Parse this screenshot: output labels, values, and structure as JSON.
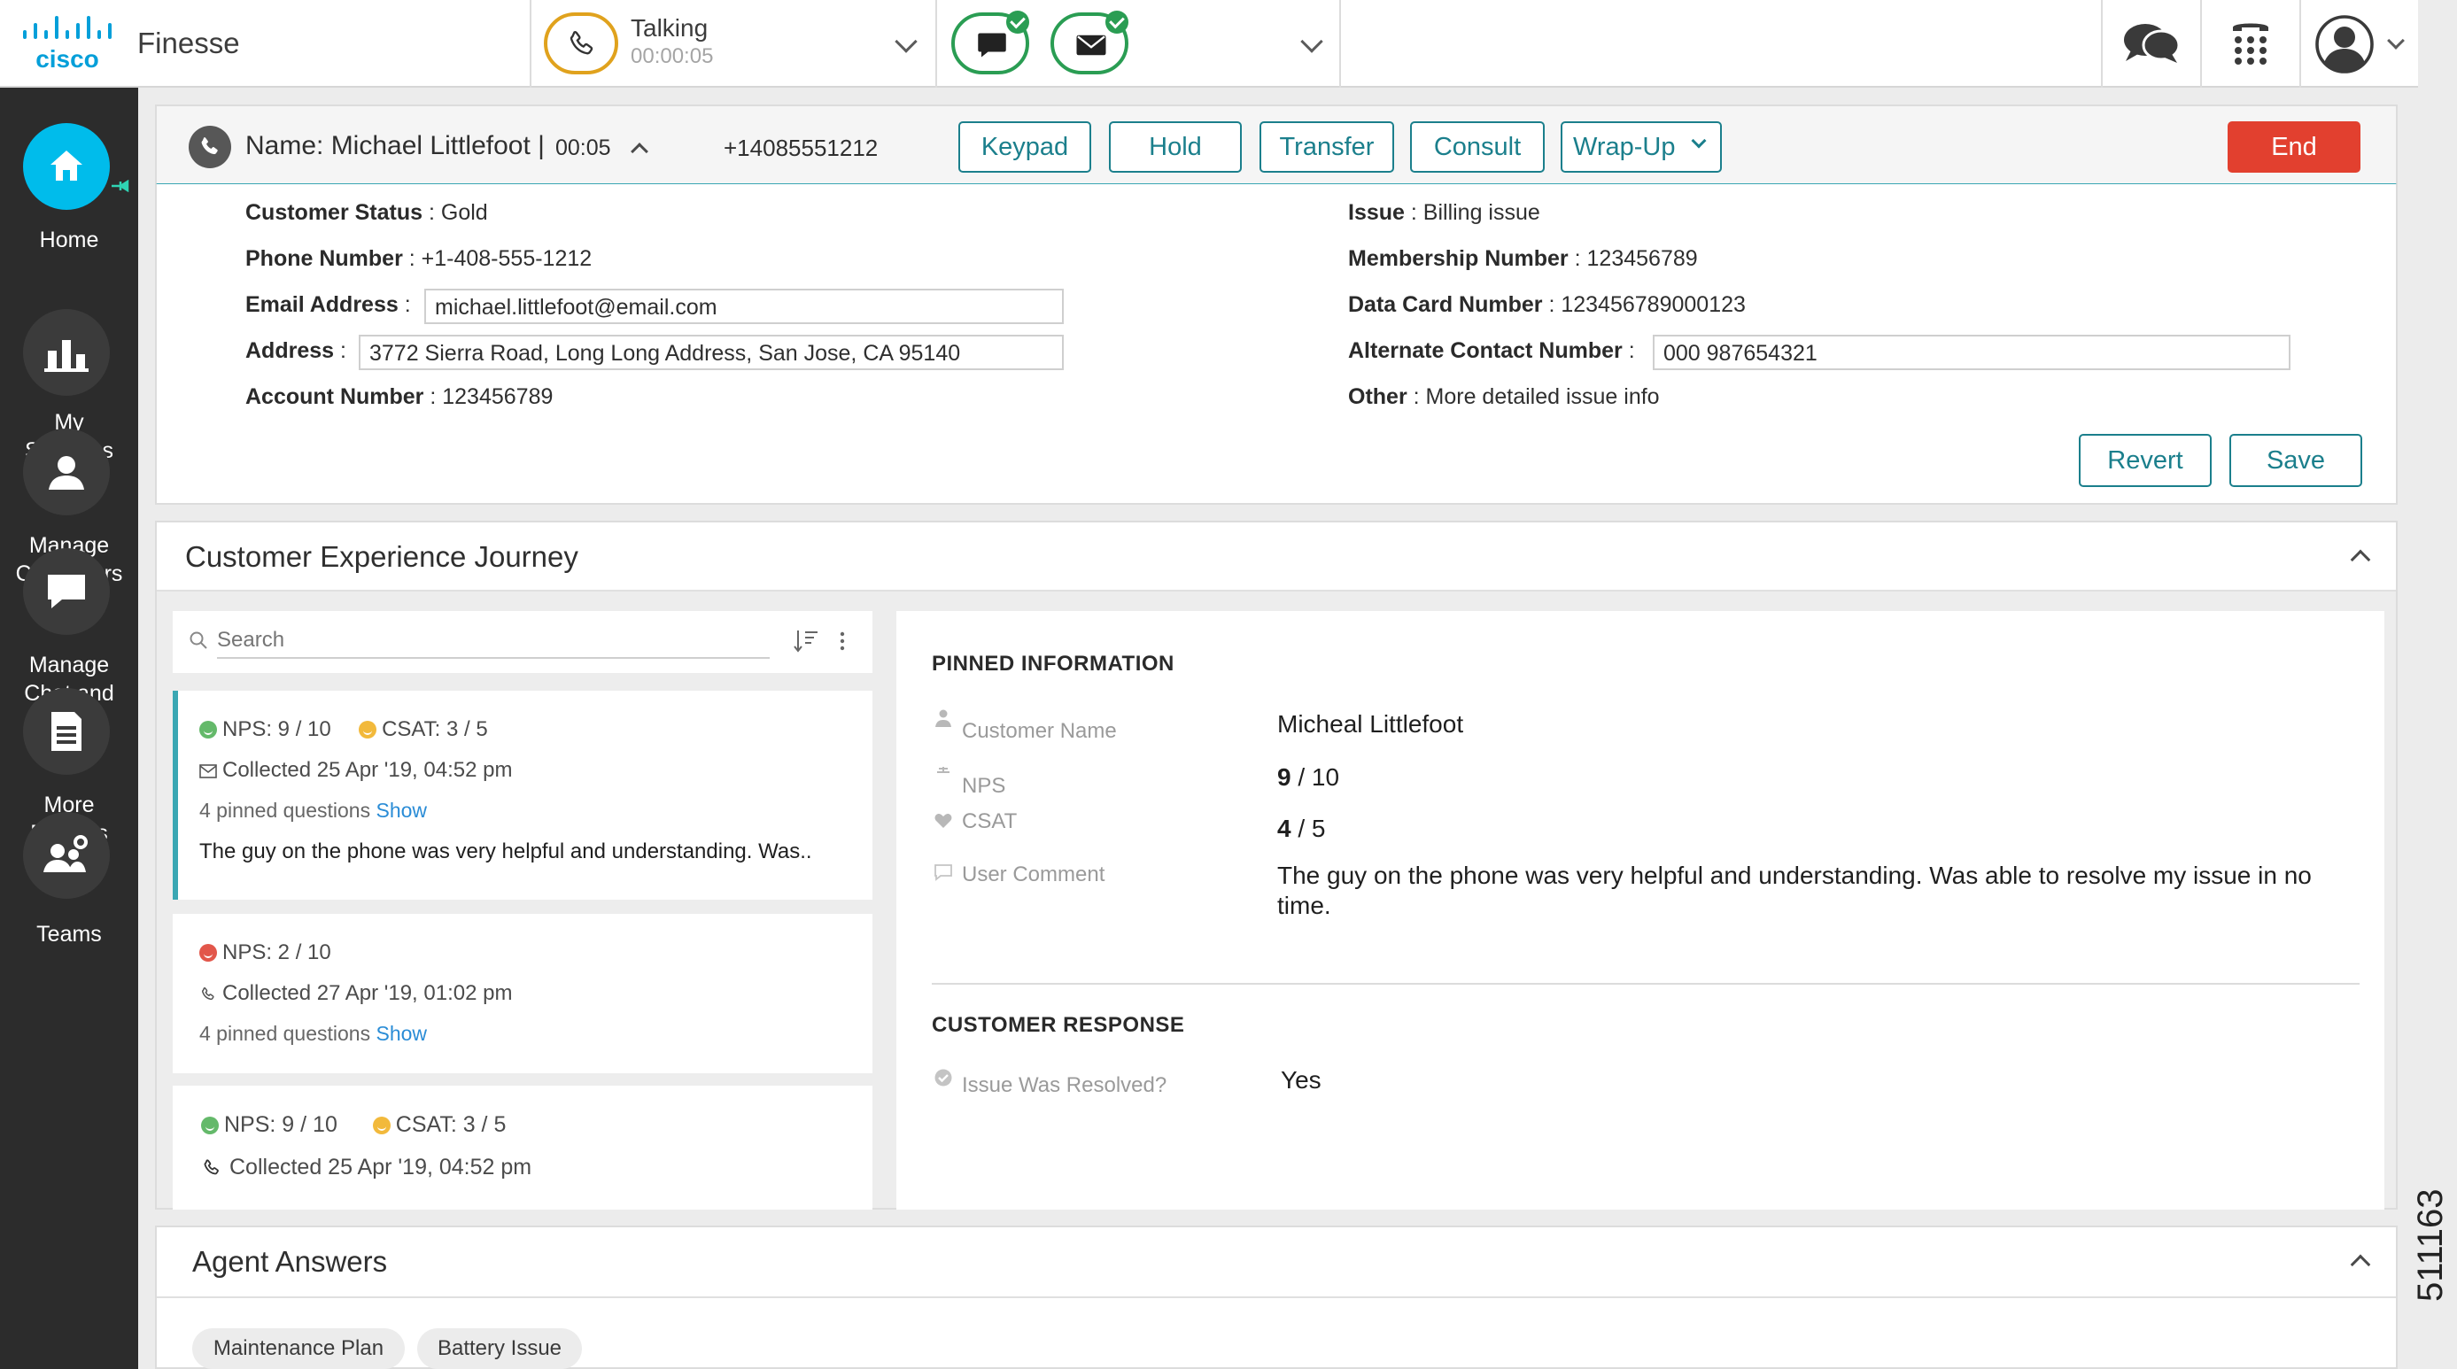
{
  "app": {
    "name": "Finesse",
    "logo_text": "cisco"
  },
  "topbar": {
    "voice": {
      "status": "Talking",
      "timer": "00:00:05"
    }
  },
  "sidebar": {
    "items": [
      {
        "label": "Home",
        "icon": "home-icon",
        "active": true
      },
      {
        "label": "My Statistics",
        "lines": [
          "My",
          "Statistics"
        ],
        "icon": "bar-chart-icon"
      },
      {
        "label": "Manage Customers",
        "lines": [
          "Manage",
          "Customers"
        ],
        "icon": "person-icon"
      },
      {
        "label": "Manage Chat and Email",
        "lines": [
          "Manage",
          "Chat and",
          "Email"
        ],
        "icon": "chat-bubble-icon"
      },
      {
        "label": "More Reports",
        "lines": [
          "More",
          "Reports"
        ],
        "icon": "report-icon"
      },
      {
        "label": "Teams",
        "lines": [
          "Teams"
        ],
        "icon": "team-settings-icon"
      }
    ]
  },
  "call": {
    "name": "Name: Michael Littlefoot |",
    "timer": "00:05",
    "number": "+14085551212",
    "buttons": {
      "keypad": "Keypad",
      "hold": "Hold",
      "transfer": "Transfer",
      "consult": "Consult",
      "wrapup": "Wrap-Up",
      "end": "End"
    },
    "fields_left": {
      "customer_status": {
        "label": "Customer Status",
        "value": ": Gold"
      },
      "phone_number": {
        "label": "Phone Number",
        "value": ": +1-408-555-1212"
      },
      "email_address": {
        "label": "Email Address",
        "colon": ":",
        "value": "michael.littlefoot@email.com"
      },
      "address": {
        "label": "Address",
        "colon": ":",
        "value": "3772 Sierra Road, Long Long Address, San Jose, CA 95140"
      },
      "account_number": {
        "label": "Account Number",
        "value": ": 123456789"
      }
    },
    "fields_right": {
      "issue": {
        "label": "Issue",
        "value": ": Billing issue"
      },
      "membership_number": {
        "label": "Membership Number",
        "value": ": 123456789"
      },
      "data_card_number": {
        "label": "Data Card Number",
        "value": ": 123456789000123"
      },
      "alternate_contact": {
        "label": "Alternate Contact Number",
        "colon": ":",
        "value": "000 987654321"
      },
      "other": {
        "label": "Other",
        "value": ": More detailed issue info"
      }
    },
    "actions": {
      "revert": "Revert",
      "save": "Save"
    }
  },
  "journey": {
    "title": "Customer Experience Journey",
    "search_placeholder": "Search",
    "cards": [
      {
        "nps": "NPS: 9 / 10",
        "csat": "CSAT: 3 / 5",
        "collected": "Collected 25 Apr '19, 04:52 pm",
        "channel_icon": "email-icon",
        "pinned": "4 pinned questions",
        "show": "Show",
        "comment": "The guy on the phone was very helpful and understanding. Was.."
      },
      {
        "nps": "NPS: 2 / 10",
        "collected": "Collected 27 Apr '19, 01:02 pm",
        "channel_icon": "phone-icon",
        "pinned": "4 pinned questions",
        "show": "Show"
      },
      {
        "nps": "NPS: 9 / 10",
        "csat": "CSAT: 3 / 5",
        "collected": "Collected 25 Apr '19, 04:52 pm",
        "channel_icon": "phone-icon"
      }
    ],
    "detail": {
      "pinned_heading": "PINNED INFORMATION",
      "customer_name_label": "Customer Name",
      "customer_name_value": "Micheal Littlefoot",
      "nps_label": "NPS",
      "nps_score": "9",
      "nps_scale": " / 10",
      "csat_label": "CSAT",
      "csat_score": "4",
      "csat_scale": " / 5",
      "comment_label": "User Comment",
      "comment_value": "The guy on the phone was very helpful and understanding. Was able to resolve my issue in no time.",
      "response_heading": "CUSTOMER RESPONSE",
      "resolved_label": "Issue Was Resolved?",
      "resolved_value": "Yes"
    }
  },
  "agent_answers": {
    "title": "Agent Answers",
    "tags": [
      "Maintenance Plan",
      "Battery Issue"
    ]
  },
  "figure_id": "511163",
  "colors": {
    "accent": "#00bceb",
    "teal": "#1b7f8c",
    "end": "#e2402f",
    "talking": "#e0a21d",
    "ready": "#2a9d53",
    "sidebar": "#2c2c2c"
  }
}
